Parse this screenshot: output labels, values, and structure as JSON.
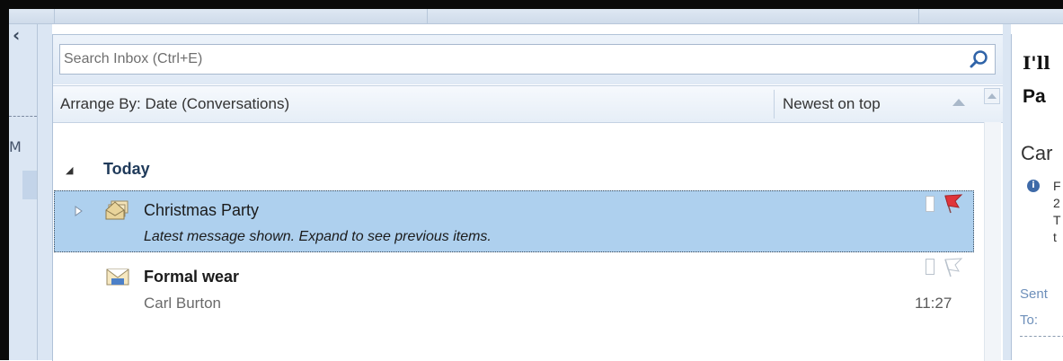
{
  "search": {
    "placeholder": "Search Inbox (Ctrl+E)"
  },
  "arrange": {
    "label": "Arrange By: Date (Conversations)",
    "sort": "Newest on top"
  },
  "nav": {
    "letter": "M"
  },
  "groups": [
    {
      "title": "Today",
      "items": [
        {
          "subject": "Christmas Party",
          "preview": "Latest message shown. Expand to see previous items.",
          "selected": true,
          "flagged": true
        },
        {
          "subject": "Formal wear",
          "sender": "Carl Burton",
          "time": "11:27",
          "unread": true,
          "flagged": false
        }
      ]
    }
  ],
  "reading": {
    "title_line1": "I'll",
    "title_line2": "Pa",
    "from": "Car",
    "info_chars": [
      "F",
      "2",
      "T",
      "t"
    ],
    "sent_label": "Sent",
    "to_label": "To:"
  },
  "colors": {
    "selection": "#aed0ee",
    "flag_red": "#e0343a",
    "group_title": "#1f3a5a",
    "pane_bg": "#dbe6f3"
  }
}
